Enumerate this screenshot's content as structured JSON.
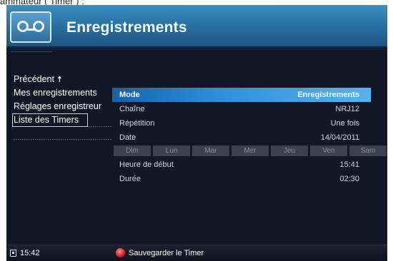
{
  "top_caption": "ammateur ( Timer ) :",
  "header": {
    "title": "Enregistrements"
  },
  "sidebar": {
    "items": [
      {
        "label": "Précédent",
        "icon": "up-arrow-icon",
        "active": false
      },
      {
        "label": "Mes enregistrements",
        "active": false
      },
      {
        "label": "Réglages enregistreur",
        "active": false
      },
      {
        "label": "Liste des Timers",
        "active": true
      }
    ]
  },
  "settings": [
    {
      "label": "Mode",
      "value": "Enregistrements",
      "selected": true
    },
    {
      "label": "Chaîne",
      "value": "NRJ12"
    },
    {
      "label": "Répétition",
      "value": "Une fois"
    },
    {
      "label": "Date",
      "value": "14/04/2011"
    }
  ],
  "days": [
    "Dim",
    "Lun",
    "Mar",
    "Mer",
    "Jeu",
    "Ven",
    "Sam"
  ],
  "time_settings": [
    {
      "label": "Heure de début",
      "value": "15:41"
    },
    {
      "label": "Durée",
      "value": "02:30"
    }
  ],
  "footer": {
    "clock_icon": "clock-icon",
    "time": "15:42",
    "red_button_icon": "red-button-icon",
    "action_label": "Sauvegarder le Timer"
  },
  "colors": {
    "header_blue": "#2a73a6",
    "background": "#121725",
    "selected_row": "#2c8fdb",
    "day_button": "#3c4151",
    "red_button": "#d51c1c"
  }
}
